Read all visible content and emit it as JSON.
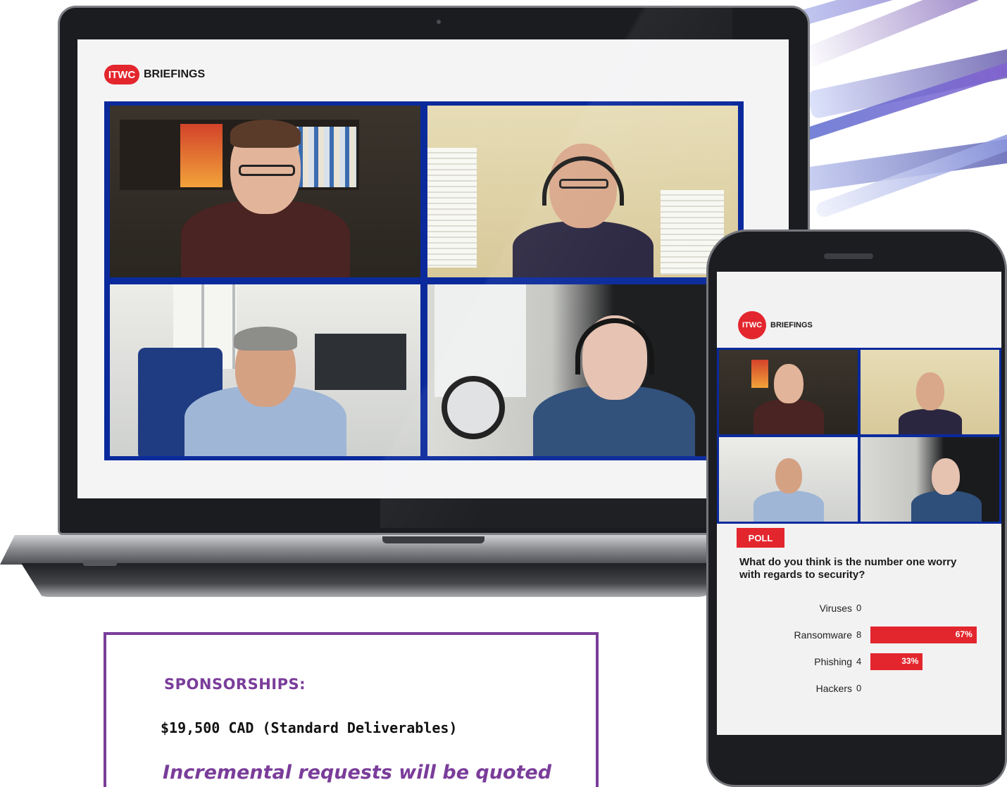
{
  "brand": {
    "logo_text": "ITWC",
    "word": "BRIEFINGS",
    "accent_color": "#e3262d",
    "grid_color": "#0a2a9c"
  },
  "participants": [
    {
      "name": "host",
      "icon": "person-glasses-icon"
    },
    {
      "name": "guest-headset",
      "icon": "person-headset-icon"
    },
    {
      "name": "guest-grey-hair",
      "icon": "person-headset-icon"
    },
    {
      "name": "guest-bald",
      "icon": "person-headset-icon"
    }
  ],
  "poll": {
    "badge": "POLL",
    "question": "What do you think is the number one worry with regards to security?",
    "options": [
      {
        "label": "Viruses",
        "count": "0",
        "percent": 0,
        "percent_label": ""
      },
      {
        "label": "Ransomware",
        "count": "8",
        "percent": 67,
        "percent_label": "67%"
      },
      {
        "label": "Phishing",
        "count": "4",
        "percent": 33,
        "percent_label": "33%"
      },
      {
        "label": "Hackers",
        "count": "0",
        "percent": 0,
        "percent_label": ""
      }
    ]
  },
  "sponsorship": {
    "title": "SPONSORSHIPS:",
    "price": "$19,500 CAD (Standard Deliverables)",
    "note": "Incremental requests will be quoted",
    "accent_color": "#7a3d9a"
  }
}
